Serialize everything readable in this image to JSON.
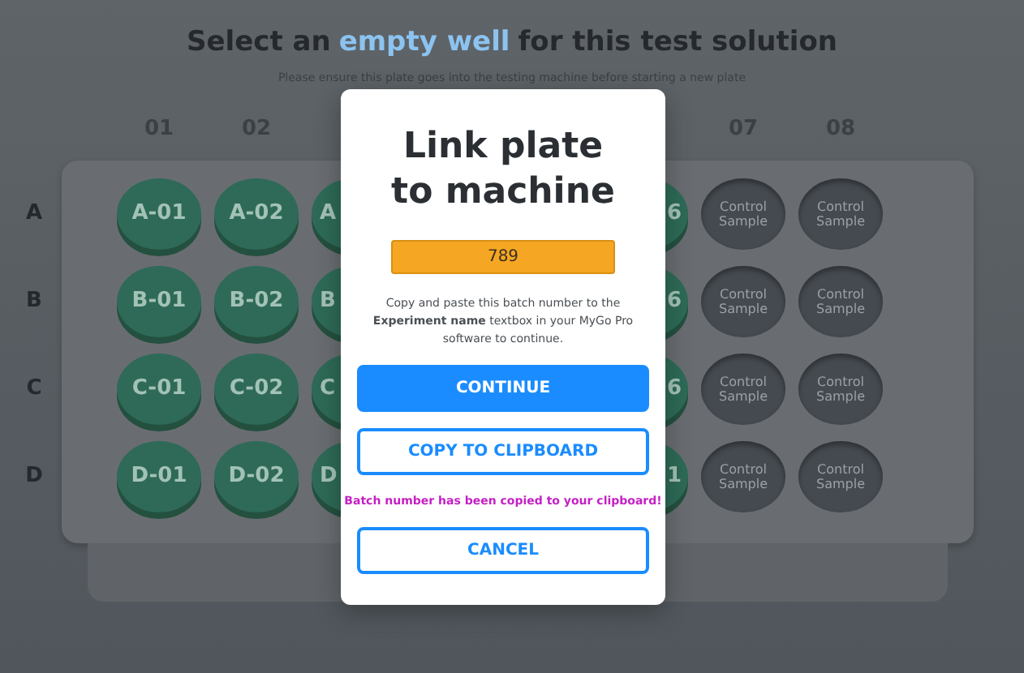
{
  "header": {
    "title": [
      {
        "text": "Select an",
        "highlight": false
      },
      {
        "text": "empty well",
        "highlight": true
      },
      {
        "text": "for this test solution",
        "highlight": false
      }
    ],
    "subtitle": "Please ensure this plate goes into the testing machine before starting a new plate"
  },
  "plate": {
    "columns": [
      {
        "kind": "label",
        "label": "01"
      },
      {
        "kind": "label",
        "label": "02"
      },
      {
        "kind": "hidden"
      },
      {
        "kind": "hidden"
      },
      {
        "kind": "hidden"
      },
      {
        "kind": "hidden"
      },
      {
        "kind": "label",
        "label": "07"
      },
      {
        "kind": "label",
        "label": "08"
      }
    ],
    "rows": [
      {
        "label": "A",
        "wells": [
          {
            "kind": "sample",
            "label": "A-01"
          },
          {
            "kind": "sample",
            "label": "A-02"
          },
          {
            "kind": "sample_left_part",
            "label": "A"
          },
          {
            "kind": "hidden"
          },
          {
            "kind": "hidden"
          },
          {
            "kind": "sample_right_part",
            "label": "6"
          },
          {
            "kind": "control",
            "label": "Control Sample"
          },
          {
            "kind": "control",
            "label": "Control Sample"
          }
        ]
      },
      {
        "label": "B",
        "wells": [
          {
            "kind": "sample",
            "label": "B-01"
          },
          {
            "kind": "sample",
            "label": "B-02"
          },
          {
            "kind": "sample_left_part",
            "label": "B"
          },
          {
            "kind": "hidden"
          },
          {
            "kind": "hidden"
          },
          {
            "kind": "sample_right_part",
            "label": "6"
          },
          {
            "kind": "control",
            "label": "Control Sample"
          },
          {
            "kind": "control",
            "label": "Control Sample"
          }
        ]
      },
      {
        "label": "C",
        "wells": [
          {
            "kind": "sample",
            "label": "C-01"
          },
          {
            "kind": "sample",
            "label": "C-02"
          },
          {
            "kind": "sample_left_part",
            "label": "C"
          },
          {
            "kind": "hidden"
          },
          {
            "kind": "hidden"
          },
          {
            "kind": "sample_right_part",
            "label": "6"
          },
          {
            "kind": "control",
            "label": "Control Sample"
          },
          {
            "kind": "control",
            "label": "Control Sample"
          }
        ]
      },
      {
        "label": "D",
        "wells": [
          {
            "kind": "sample",
            "label": "D-01"
          },
          {
            "kind": "sample",
            "label": "D-02"
          },
          {
            "kind": "sample_left_part",
            "label": "D"
          },
          {
            "kind": "hidden"
          },
          {
            "kind": "hidden"
          },
          {
            "kind": "sample_right_part",
            "label": "1"
          },
          {
            "kind": "control",
            "label": "Control Sample"
          },
          {
            "kind": "control",
            "label": "Control Sample"
          }
        ]
      }
    ]
  },
  "dialog": {
    "title_lines": [
      "Link plate",
      "to machine"
    ],
    "batch_number": "789",
    "instructions": "Copy and paste this batch number to the **Experiment name** textbox in your MyGo Pro software to continue.",
    "buttons": [
      {
        "label": "CONTINUE",
        "kind": "primary"
      },
      {
        "label": "COPY TO CLIPBOARD",
        "kind": "outline"
      }
    ],
    "message": "Batch number has been copied to your clipboard!",
    "cancel": {
      "label": "CANCEL",
      "kind": "outline"
    }
  }
}
